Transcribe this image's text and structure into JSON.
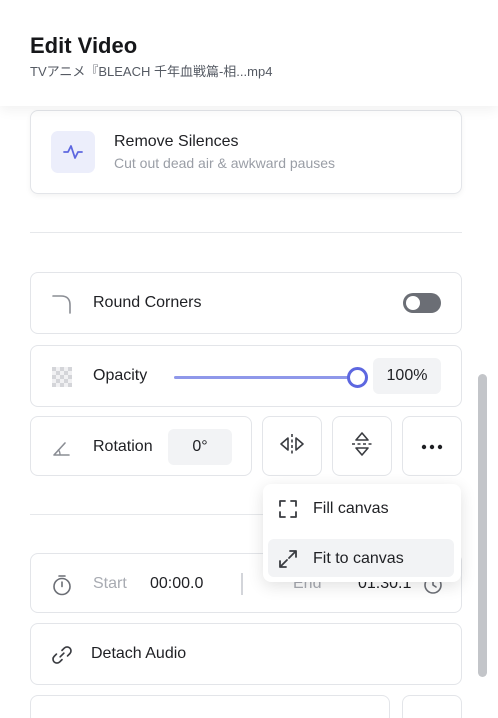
{
  "header": {
    "title": "Edit Video",
    "filename": "TVアニメ『BLEACH 千年血戦篇-相...mp4"
  },
  "remove_silences": {
    "title": "Remove Silences",
    "subtitle": "Cut out dead air & awkward pauses",
    "icon": "waveform-icon"
  },
  "round_corners": {
    "label": "Round Corners",
    "enabled": false
  },
  "opacity": {
    "label": "Opacity",
    "value": "100%",
    "level": 1.0
  },
  "rotation": {
    "label": "Rotation",
    "value": "0°"
  },
  "transform_buttons": [
    "flip-horizontal-icon",
    "flip-vertical-icon",
    "more-icon"
  ],
  "fit_menu": {
    "items": [
      {
        "label": "Fill canvas",
        "icon": "fill-canvas-icon"
      },
      {
        "label": "Fit to canvas",
        "icon": "fit-to-canvas-icon",
        "highlighted": true
      }
    ]
  },
  "timing": {
    "start_label": "Start",
    "start_value": "00:00.0",
    "end_label": "End",
    "end_value": "01:30.1"
  },
  "detach_audio": {
    "label": "Detach Audio"
  },
  "colors": {
    "accent": "#5d67e0",
    "slider_fill": "#8f98ea",
    "icon_bg": "#eceefb"
  }
}
